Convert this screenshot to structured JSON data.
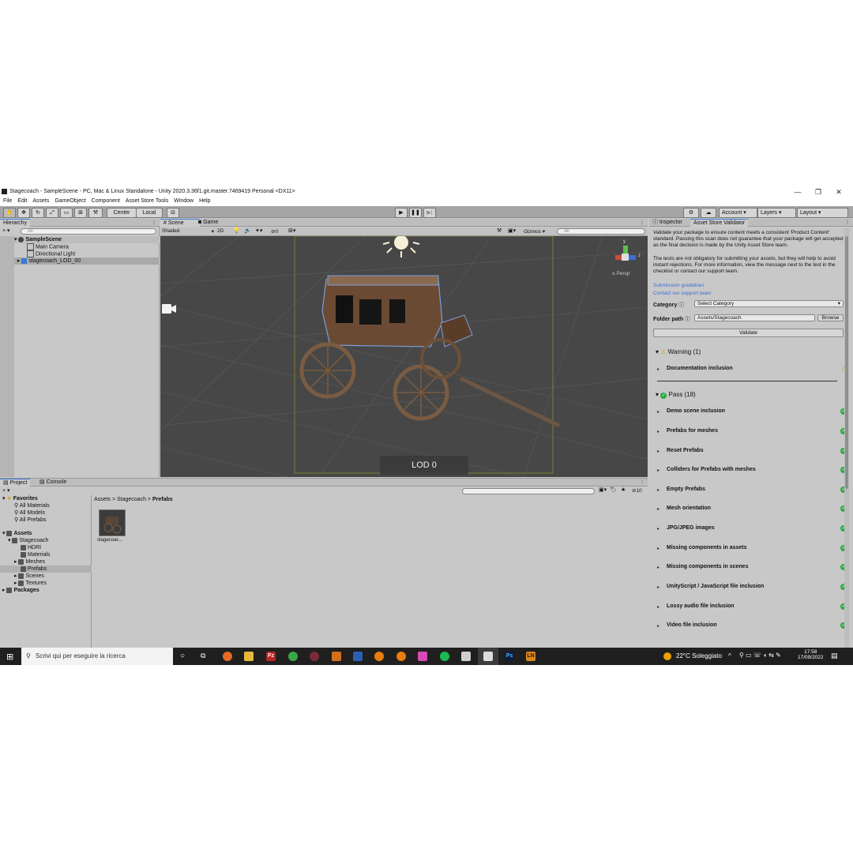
{
  "window": {
    "title": "Stagecoach - SampleScene - PC, Mac & Linux Standalone - Unity 2020.3.36f1.git.master.7469419 Personal <DX11>",
    "controls": [
      "—",
      "❐",
      "✕"
    ]
  },
  "menu": [
    "File",
    "Edit",
    "Assets",
    "GameObject",
    "Component",
    "Asset Store Tools",
    "Window",
    "Help"
  ],
  "toolbar": {
    "pivot": "Center",
    "space": "Local",
    "account": "Account",
    "layers": "Layers",
    "layout": "Layout"
  },
  "hierarchy": {
    "tab": "Hierarchy",
    "search_placeholder": "All",
    "scene": "SampleScene",
    "items": [
      "Main Camera",
      "Directional Light",
      "stagecoach_LOD_00"
    ]
  },
  "scene_view": {
    "tabs": [
      "Scene",
      "Game"
    ],
    "shading": "Shaded",
    "mode_2d": "2D",
    "fx_count": "0",
    "gizmos": "Gizmos",
    "search_placeholder": "All",
    "persp": "Persp",
    "lod_label": "LOD 0",
    "axis_y": "y",
    "axis_z": "z"
  },
  "project": {
    "tabs": [
      "Project",
      "Console"
    ],
    "favorites_label": "Favorites",
    "favorites": [
      "All Materials",
      "All Models",
      "All Prefabs"
    ],
    "assets_label": "Assets",
    "stagecoach": "Stagecoach",
    "folders": [
      "HDRI",
      "Materials",
      "Meshes",
      "Prefabs",
      "Scenes",
      "Textures"
    ],
    "packages": "Packages",
    "breadcrumb": [
      "Assets",
      "Stagecoach",
      "Prefabs"
    ],
    "asset_name": "stagecoac...",
    "count": "10"
  },
  "inspector": {
    "tabs": [
      "Inspector",
      "Asset Store Validator"
    ],
    "intro1": "Validate your package to ensure content meets a consistent 'Product Content' standard. Passing this scan does not guarantee that your package will get accepted as the final decision is made by the Unity Asset Store team.",
    "intro2": "The tests are not obligatory for submitting your assets, but they will help to avoid instant rejections. For more information, view the message next to the test in the checklist or contact our support team.",
    "link1": "Submission guidelines",
    "link2": "Contact our support team",
    "category_label": "Category",
    "category_value": "Select Category",
    "folder_label": "Folder path",
    "folder_value": "Assets/Stagecoach",
    "browse": "Browse",
    "validate": "Validate",
    "warning_header": "Warning (1)",
    "warning_items": [
      "Documentation inclusion"
    ],
    "pass_header": "Pass (18)",
    "pass_items": [
      "Demo scene inclusion",
      "Prefabs for meshes",
      "Reset Prefabs",
      "Colliders for Prefabs with meshes",
      "Empty Prefabs",
      "Mesh orientation",
      "JPG/JPEG images",
      "Missing components in assets",
      "Missing components in scenes",
      "UnityScript / JavaScript file inclusion",
      "Lossy audio file inclusion",
      "Video file inclusion"
    ]
  },
  "taskbar": {
    "search_placeholder": "Scrivi qui per eseguire la ricerca",
    "weather": "22°C  Soleggiato",
    "time": "17:58",
    "date": "17/09/2022",
    "app_labels": [
      "Fz",
      "Ps",
      "LN"
    ]
  },
  "colors": {
    "unity_panel": "#c8c8c8",
    "scene_bg": "#474747",
    "pass_green": "#2bab43",
    "warning_yellow": "#f0b400",
    "link_blue": "#3a6fd6",
    "taskbar": "#1f1f1f"
  }
}
